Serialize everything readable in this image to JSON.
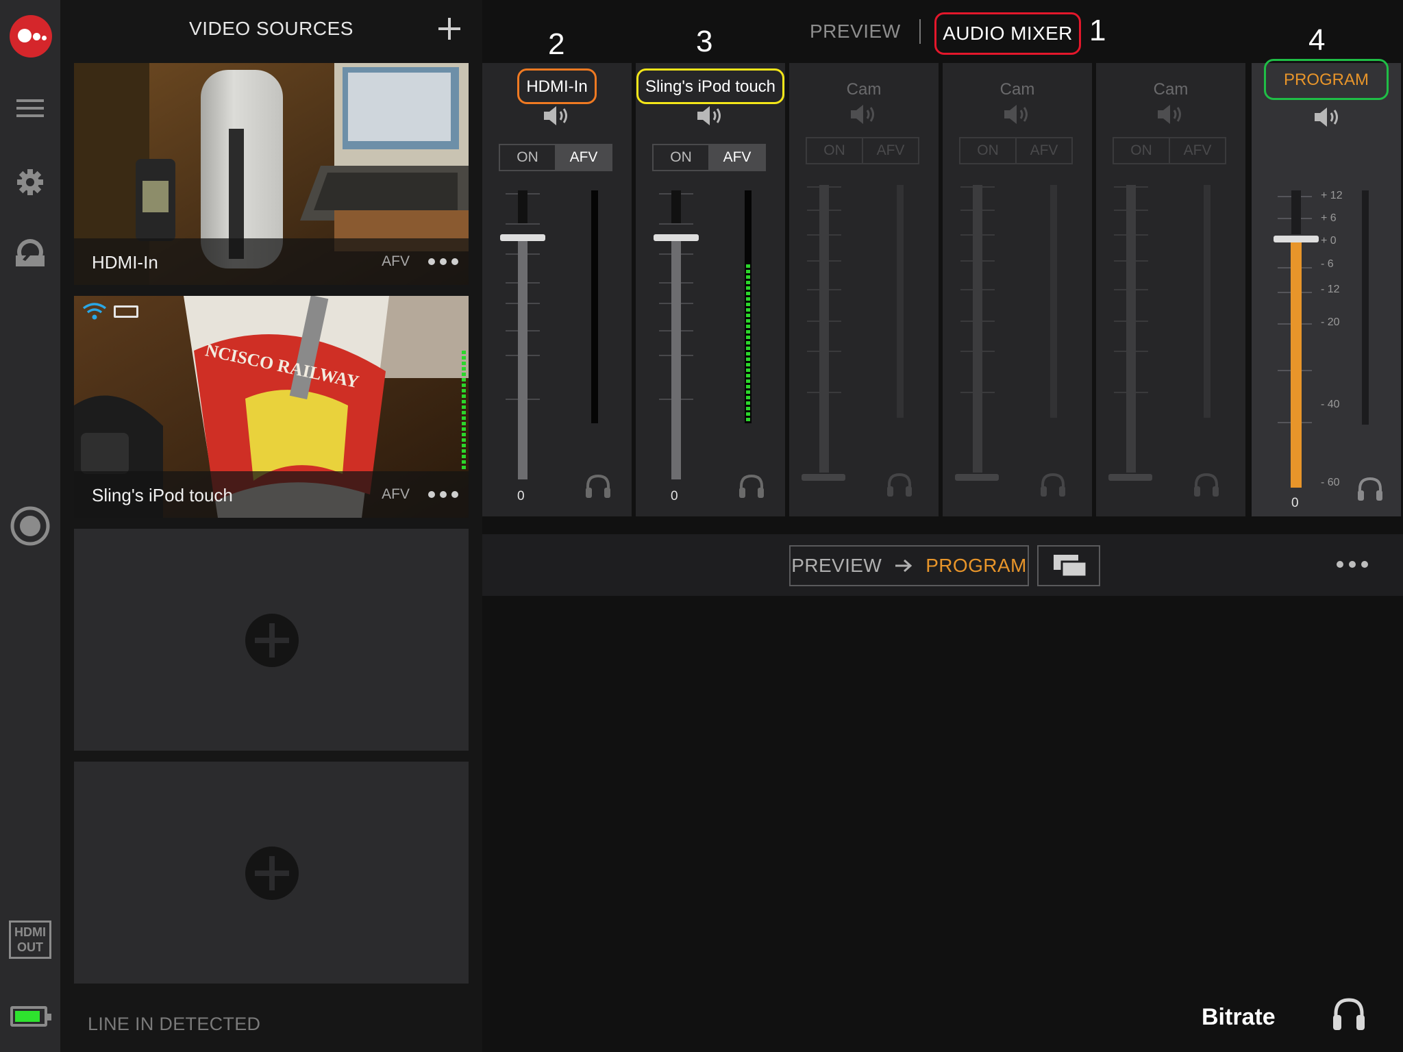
{
  "sources": {
    "title": "VIDEO SOURCES",
    "tiles": [
      {
        "name": "HDMI-In",
        "afv": "AFV"
      },
      {
        "name": "Sling's iPod touch",
        "afv": "AFV"
      }
    ],
    "status": "LINE IN DETECTED"
  },
  "rail": {
    "hdmi_out_line1": "HDMI",
    "hdmi_out_line2": "OUT",
    "battery_level": 0.9
  },
  "tabs": {
    "preview": "PREVIEW",
    "audio_mixer": "AUDIO MIXER"
  },
  "annotations": [
    "1",
    "2",
    "3",
    "4"
  ],
  "mixer": {
    "channels": [
      {
        "name": "HDMI-In",
        "on": "ON",
        "afv": "AFV",
        "value": "0",
        "active": true
      },
      {
        "name": "Sling's iPod touch",
        "on": "ON",
        "afv": "AFV",
        "value": "0",
        "active": true
      },
      {
        "name": "Cam",
        "on": "ON",
        "afv": "AFV",
        "active": false
      },
      {
        "name": "Cam",
        "on": "ON",
        "afv": "AFV",
        "active": false
      },
      {
        "name": "Cam",
        "on": "ON",
        "afv": "AFV",
        "active": false
      }
    ],
    "program": {
      "name": "PROGRAM",
      "value": "0",
      "db_scale": [
        "+ 12",
        "+ 6",
        "+ 0",
        "- 6",
        "- 12",
        "- 20",
        "- 40",
        "- 60"
      ]
    }
  },
  "transition": {
    "from": "PREVIEW",
    "to": "PROGRAM"
  },
  "footer": {
    "bitrate": "Bitrate"
  },
  "colors": {
    "accent_orange": "#e8952a",
    "annotation_red": "#e3172b",
    "annotation_orange": "#f07a22",
    "annotation_yellow": "#f4e619",
    "annotation_green": "#1fbe46",
    "meter_green": "#2bd62b",
    "battery_green": "#2ee32e",
    "logo_red": "#d5262b",
    "wifi_blue": "#2aa7e6"
  }
}
